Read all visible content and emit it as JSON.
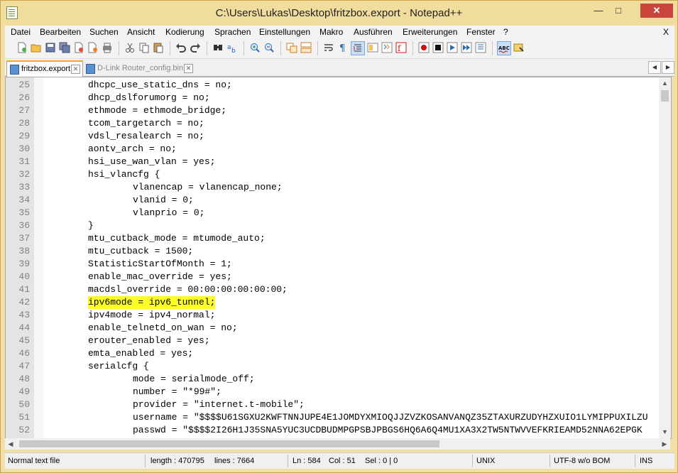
{
  "window": {
    "title": "C:\\Users\\Lukas\\Desktop\\fritzbox.export - Notepad++",
    "min_label": "—",
    "max_label": "□",
    "close_label": "✕"
  },
  "menu": {
    "items": [
      "Datei",
      "Bearbeiten",
      "Suchen",
      "Ansicht",
      "Kodierung",
      "Sprachen",
      "Einstellungen",
      "Makro",
      "Ausführen",
      "Erweiterungen",
      "Fenster",
      "?"
    ],
    "close_label": "X"
  },
  "tabs": [
    {
      "label": "fritzbox.export",
      "close": "✕"
    },
    {
      "label": "D-Link Router_config.bin",
      "close": "✕"
    }
  ],
  "tab_nav": {
    "left": "◀",
    "right": "▶"
  },
  "editor": {
    "lines": [
      {
        "n": "25",
        "text": "dhcpc_use_static_dns = no;",
        "indent": 1
      },
      {
        "n": "26",
        "text": "dhcp_dslforumorg = no;",
        "indent": 1
      },
      {
        "n": "27",
        "text": "ethmode = ethmode_bridge;",
        "indent": 1
      },
      {
        "n": "28",
        "text": "tcom_targetarch = no;",
        "indent": 1
      },
      {
        "n": "29",
        "text": "vdsl_resalearch = no;",
        "indent": 1
      },
      {
        "n": "30",
        "text": "aontv_arch = no;",
        "indent": 1
      },
      {
        "n": "31",
        "text": "hsi_use_wan_vlan = yes;",
        "indent": 1
      },
      {
        "n": "32",
        "text": "hsi_vlancfg {",
        "indent": 1
      },
      {
        "n": "33",
        "text": "vlanencap = vlanencap_none;",
        "indent": 2
      },
      {
        "n": "34",
        "text": "vlanid = 0;",
        "indent": 2
      },
      {
        "n": "35",
        "text": "vlanprio = 0;",
        "indent": 2
      },
      {
        "n": "36",
        "text": "}",
        "indent": 1
      },
      {
        "n": "37",
        "text": "mtu_cutback_mode = mtumode_auto;",
        "indent": 1
      },
      {
        "n": "38",
        "text": "mtu_cutback = 1500;",
        "indent": 1
      },
      {
        "n": "39",
        "text": "StatisticStartOfMonth = 1;",
        "indent": 1
      },
      {
        "n": "40",
        "text": "enable_mac_override = yes;",
        "indent": 1
      },
      {
        "n": "41",
        "text": "macdsl_override = 00:00:00:00:00:00;",
        "indent": 1
      },
      {
        "n": "42",
        "text": "ipv6mode = ipv6_tunnel;",
        "indent": 1,
        "highlight": true
      },
      {
        "n": "43",
        "text": "ipv4mode = ipv4_normal;",
        "indent": 1
      },
      {
        "n": "44",
        "text": "enable_telnetd_on_wan = no;",
        "indent": 1
      },
      {
        "n": "45",
        "text": "erouter_enabled = yes;",
        "indent": 1
      },
      {
        "n": "46",
        "text": "emta_enabled = yes;",
        "indent": 1
      },
      {
        "n": "47",
        "text": "serialcfg {",
        "indent": 1
      },
      {
        "n": "48",
        "text": "mode = serialmode_off;",
        "indent": 2
      },
      {
        "n": "49",
        "text": "number = \"*99#\";",
        "indent": 2
      },
      {
        "n": "50",
        "text": "provider = \"internet.t-mobile\";",
        "indent": 2
      },
      {
        "n": "51",
        "text": "username = \"$$$$U61SGXU2KWFTNNJUPE4E1JOMDYXMIOQJJZVZKOSANVANQZ35ZTAXURZUDYHZXUIO1LYMIPPUXILZU",
        "indent": 2
      },
      {
        "n": "52",
        "text": "passwd = \"$$$$2I26H1J35SNA5YUC3UCDBUDMPGPSBJPBGS6HQ6A6Q4MU1XA3X2TW5NTWVVEFKRIEAMD52NNA62EPGK",
        "indent": 2
      }
    ]
  },
  "scroll": {
    "up": "▲",
    "down": "▼",
    "left": "◀",
    "right": "▶"
  },
  "status": {
    "filetype": "Normal text file",
    "length": "length : 470795",
    "lines": "lines : 7664",
    "ln": "Ln : 584",
    "col": "Col : 51",
    "sel": "Sel : 0 | 0",
    "eol": "UNIX",
    "encoding": "UTF-8 w/o BOM",
    "mode": "INS"
  },
  "toolbar_icons": [
    "new-file-icon",
    "open-file-icon",
    "save-icon",
    "save-all-icon",
    "close-icon",
    "close-all-icon",
    "print-icon",
    "cut-icon",
    "copy-icon",
    "paste-icon",
    "undo-icon",
    "redo-icon",
    "find-icon",
    "replace-icon",
    "zoom-in-icon",
    "zoom-out-icon",
    "sync-v-icon",
    "sync-h-icon",
    "word-wrap-icon",
    "show-all-chars-icon",
    "indent-guide-icon",
    "doc-map-icon",
    "function-list-icon",
    "record-macro-icon",
    "stop-record-icon",
    "play-macro-icon",
    "run-macro-multiple-icon",
    "save-macro-icon",
    "spellcheck-icon",
    "plugin-icon"
  ]
}
